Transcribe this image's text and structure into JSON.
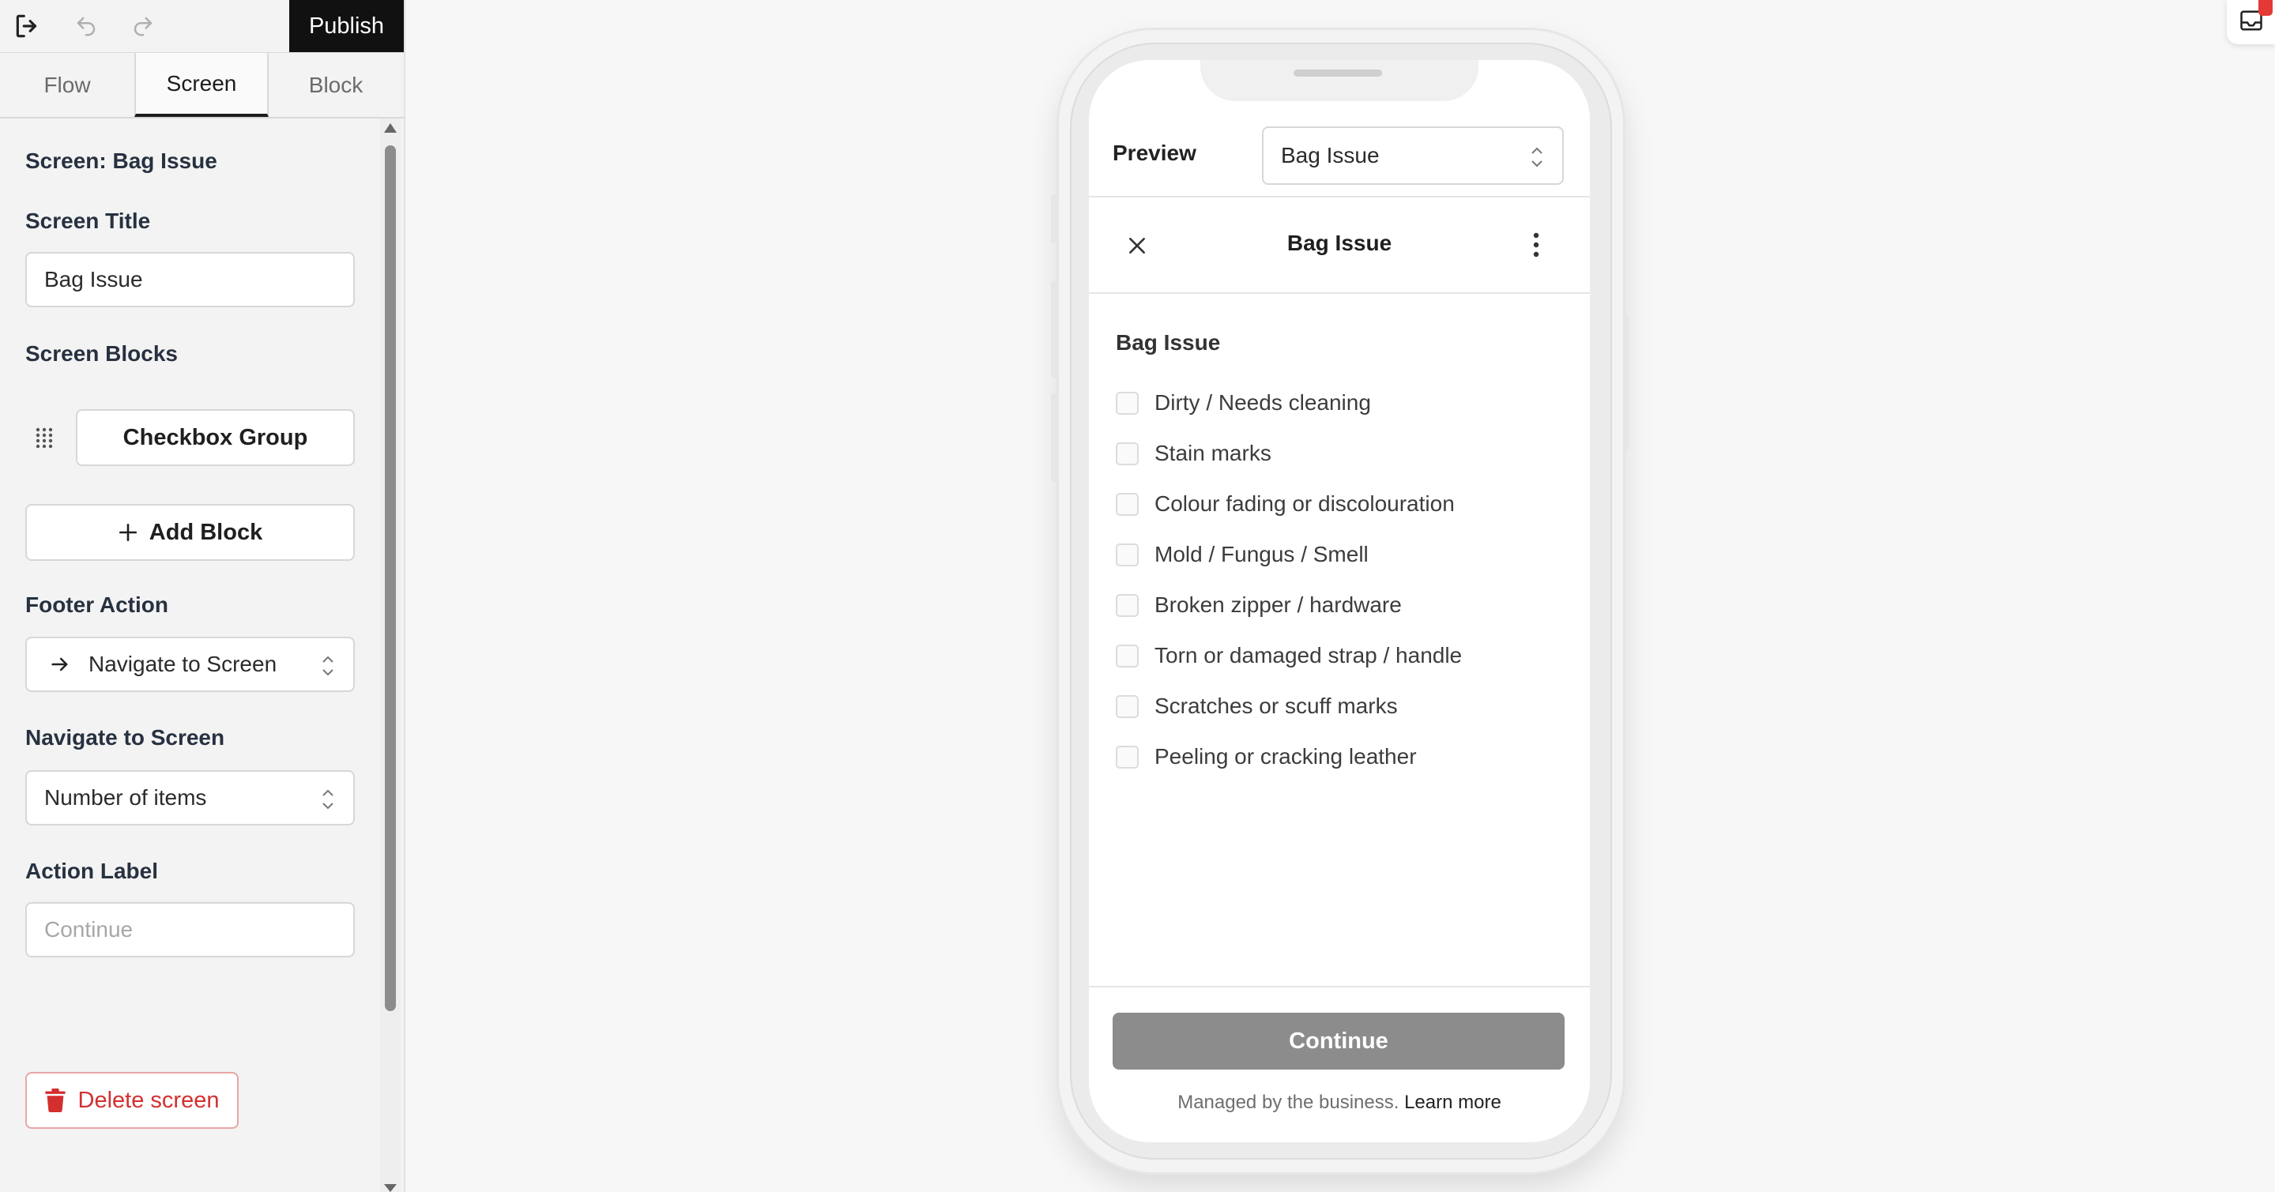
{
  "toolbar": {
    "exit_icon": "exit-icon",
    "undo_icon": "undo-icon",
    "redo_icon": "redo-icon",
    "publish_label": "Publish"
  },
  "tabs": [
    {
      "label": "Flow",
      "active": false
    },
    {
      "label": "Screen",
      "active": true
    },
    {
      "label": "Block",
      "active": false
    }
  ],
  "editor": {
    "screen_heading": "Screen: Bag Issue",
    "screen_title_label": "Screen Title",
    "screen_title_value": "Bag Issue",
    "screen_blocks_label": "Screen Blocks",
    "blocks": [
      {
        "label": "Checkbox Group"
      }
    ],
    "add_block_label": "Add Block",
    "footer_action_label": "Footer Action",
    "footer_action_value": "Navigate to Screen",
    "navigate_label": "Navigate to Screen",
    "navigate_value": "Number of items",
    "action_label_label": "Action Label",
    "action_label_placeholder": "Continue",
    "delete_label": "Delete screen"
  },
  "preview": {
    "label": "Preview",
    "selected_screen": "Bag Issue",
    "app_title": "Bag Issue",
    "group_label": "Bag Issue",
    "options": [
      "Dirty / Needs cleaning",
      "Stain marks",
      "Colour fading or discolouration",
      "Mold / Fungus / Smell",
      "Broken zipper / hardware",
      "Torn or damaged strap / handle",
      "Scratches or scuff marks",
      "Peeling or cracking leather"
    ],
    "continue_label": "Continue",
    "managed_text": "Managed by the business.",
    "learn_more": "Learn more"
  },
  "colors": {
    "publish_bg": "#111111",
    "delete_red": "#d32f2f",
    "continue_disabled": "#8c8c8c"
  }
}
